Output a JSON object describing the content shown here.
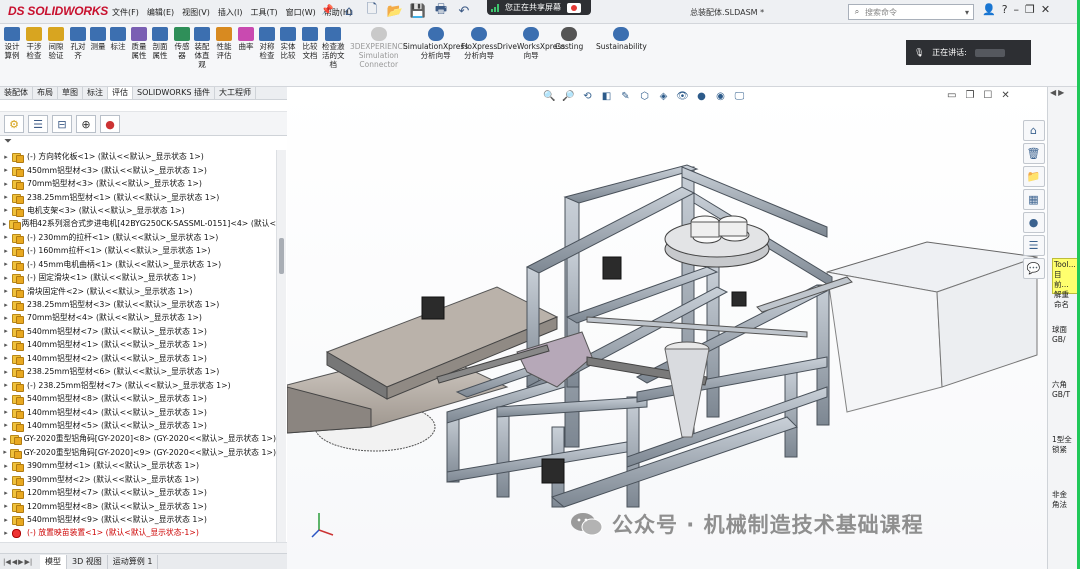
{
  "app": {
    "brand": "SOLIDWORKS",
    "brand_prefix": "DS",
    "document_title": "总装配体.SLDASM *"
  },
  "menu": [
    "文件(F)",
    "编辑(E)",
    "视图(V)",
    "插入(I)",
    "工具(T)",
    "窗口(W)",
    "帮助(H)"
  ],
  "share_banner": {
    "text": "您正在共享屏幕"
  },
  "search": {
    "placeholder": "搜索命令"
  },
  "ribbon": {
    "tools": [
      {
        "label": "设计\n算例"
      },
      {
        "label": "干涉\n检查"
      },
      {
        "label": "间隙\n验证"
      },
      {
        "label": "孔对\n齐"
      },
      {
        "label": "测量"
      },
      {
        "label": "标注"
      },
      {
        "label": "质量\n属性"
      },
      {
        "label": "剖面\n属性"
      },
      {
        "label": "传感\n器"
      },
      {
        "label": "装配\n体直\n观"
      },
      {
        "label": "性能\n评估"
      },
      {
        "label": "曲率"
      },
      {
        "label": "对称\n检查"
      },
      {
        "label": "实体\n比较"
      },
      {
        "label": "比较\n文档"
      },
      {
        "label": "检查激\n活的文\n档"
      }
    ],
    "addins": [
      {
        "label": "3DEXPERIENCE\nSimulation\nConnector"
      },
      {
        "label": "SimulationXpress\n分析向导"
      },
      {
        "label": "FloXpress\n分析向导"
      },
      {
        "label": "DriveWorksXpress\n向导"
      },
      {
        "label": "Costing"
      },
      {
        "label": "Sustainability"
      }
    ]
  },
  "speaking": {
    "label": "正在讲话:"
  },
  "command_tabs": [
    "装配体",
    "布局",
    "草图",
    "标注",
    "评估",
    "SOLIDWORKS 插件",
    "大工程师"
  ],
  "active_command_tab": "评估",
  "feature_tree": {
    "items": [
      "(-) 方向转化板<1> (默认<<默认>_显示状态 1>)",
      "450mm铝型材<3> (默认<<默认>_显示状态 1>)",
      "70mm铝型材<3> (默认<<默认>_显示状态 1>)",
      "238.25mm铝型材<1> (默认<<默认>_显示状态 1>)",
      "电机支架<3> (默认<<默认>_显示状态 1>)",
      "两相42系列混合式步进电机[42BYG250CK-SASSML-0151]<4> (默认<",
      "(-) 230mm的拉杆<1> (默认<<默认>_显示状态 1>)",
      "(-) 160mm拉杆<1> (默认<<默认>_显示状态 1>)",
      "(-) 45mm电机曲柄<1> (默认<<默认>_显示状态 1>)",
      "(-) 固定滑块<1> (默认<<默认>_显示状态 1>)",
      "滑块固定件<2> (默认<<默认>_显示状态 1>)",
      "238.25mm铝型材<3> (默认<<默认>_显示状态 1>)",
      "70mm铝型材<4> (默认<<默认>_显示状态 1>)",
      "540mm铝型材<7> (默认<<默认>_显示状态 1>)",
      "140mm铝型材<1> (默认<<默认>_显示状态 1>)",
      "140mm铝型材<2> (默认<<默认>_显示状态 1>)",
      "238.25mm铝型材<6> (默认<<默认>_显示状态 1>)",
      "(-) 238.25mm铝型材<7> (默认<<默认>_显示状态 1>)",
      "540mm铝型材<8> (默认<<默认>_显示状态 1>)",
      "140mm铝型材<4> (默认<<默认>_显示状态 1>)",
      "140mm铝型材<5> (默认<<默认>_显示状态 1>)",
      "GY-2020重型铝角码[GY-2020]<8> (GY-2020<<默认>_显示状态 1>)",
      "GY-2020重型铝角码[GY-2020]<9> (GY-2020<<默认>_显示状态 1>)",
      "390mm型材<1> (默认<<默认>_显示状态 1>)",
      "390mm型材<2> (默认<<默认>_显示状态 1>)",
      "120mm铝型材<7> (默认<<默认>_显示状态 1>)",
      "120mm铝型材<8> (默认<<默认>_显示状态 1>)",
      "540mm铝型材<9> (默认<<默认>_显示状态 1>)",
      "(-) 放置映苗装置<1> (默认<默认_显示状态-1>)"
    ],
    "error_item_index": 28
  },
  "bottom_tabs": [
    "模型",
    "3D 视图",
    "运动算例 1"
  ],
  "active_bottom_tab": "模型",
  "right_panel": {
    "tool_tag": "Tool...\n目前...\n解重命名",
    "items": [
      "球面\nGB/",
      "六角\nGB/T",
      "1型全\n锁紧",
      "非金\n角法"
    ]
  },
  "watermark": {
    "text": "公众号 · 机械制造技术基础课程"
  },
  "colors": {
    "brand_red": "#c8102e",
    "frame_aluminum": "#9aa3ad",
    "error_red": "#cc0000",
    "green_border": "#21c85a"
  }
}
